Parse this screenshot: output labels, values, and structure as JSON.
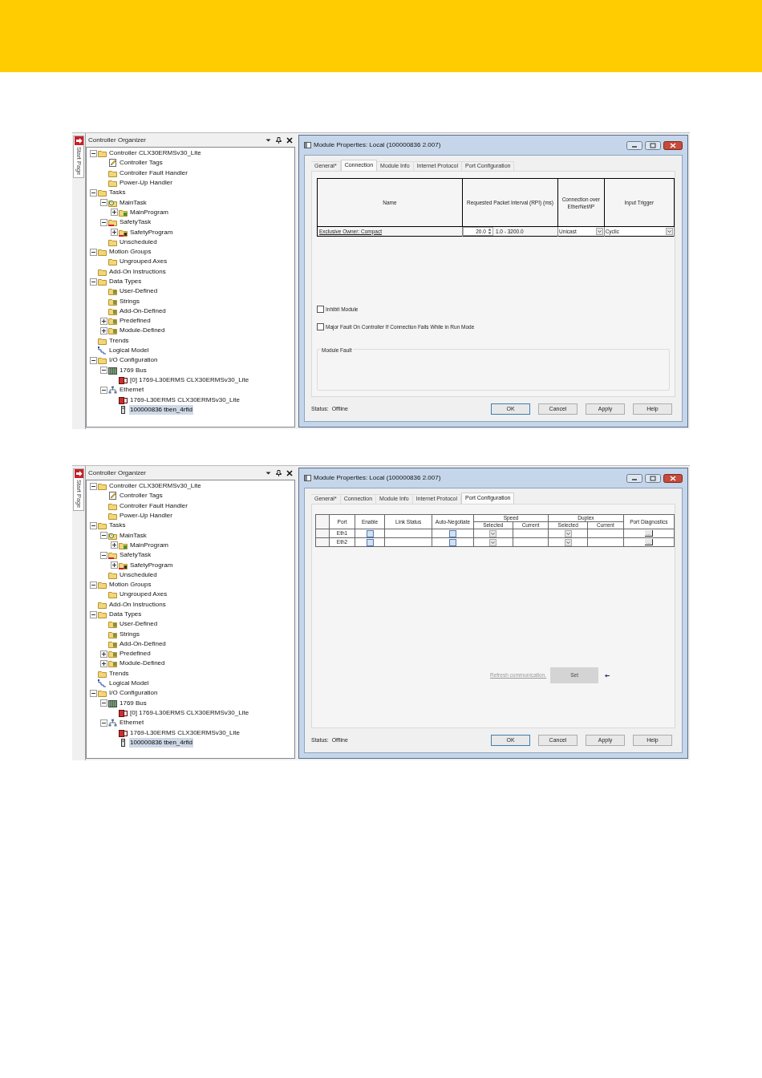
{
  "screens": [
    {
      "organizer": {
        "start_tab": "Start Page",
        "title": "Controller Organizer",
        "tree": [
          {
            "label": "Controller CLX30ERMSv30_Lite",
            "kind": "folder",
            "expanded": true,
            "selected": false,
            "children": [
              {
                "label": "Controller Tags",
                "kind": "tags",
                "selected": false
              },
              {
                "label": "Controller Fault Handler",
                "kind": "folder",
                "selected": false
              },
              {
                "label": "Power-Up Handler",
                "kind": "folder",
                "selected": false
              }
            ]
          },
          {
            "label": "Tasks",
            "kind": "folder",
            "expanded": true,
            "selected": false,
            "children": [
              {
                "label": "MainTask",
                "kind": "task",
                "expanded": true,
                "selected": false,
                "children": [
                  {
                    "label": "MainProgram",
                    "kind": "program",
                    "expanded": false,
                    "selected": false
                  }
                ]
              },
              {
                "label": "SafetyTask",
                "kind": "safety_task",
                "expanded": true,
                "selected": false,
                "children": [
                  {
                    "label": "SafetyProgram",
                    "kind": "safety_program",
                    "expanded": false,
                    "selected": false
                  }
                ]
              },
              {
                "label": "Unscheduled",
                "kind": "folder",
                "selected": false
              }
            ]
          },
          {
            "label": "Motion Groups",
            "kind": "folder",
            "expanded": true,
            "selected": false,
            "children": [
              {
                "label": "Ungrouped Axes",
                "kind": "folder",
                "selected": false
              }
            ]
          },
          {
            "label": "Add-On Instructions",
            "kind": "folder",
            "selected": false
          },
          {
            "label": "Data Types",
            "kind": "folder",
            "expanded": true,
            "selected": false,
            "children": [
              {
                "label": "User-Defined",
                "kind": "datatype",
                "selected": false
              },
              {
                "label": "Strings",
                "kind": "datatype",
                "selected": false
              },
              {
                "label": "Add-On-Defined",
                "kind": "datatype",
                "selected": false
              },
              {
                "label": "Predefined",
                "kind": "datatype",
                "expanded": false,
                "selected": false
              },
              {
                "label": "Module-Defined",
                "kind": "datatype",
                "expanded": false,
                "selected": false
              }
            ]
          },
          {
            "label": "Trends",
            "kind": "folder",
            "selected": false
          },
          {
            "label": "Logical Model",
            "kind": "logical",
            "selected": false
          },
          {
            "label": "I/O Configuration",
            "kind": "folder",
            "expanded": true,
            "selected": false,
            "children": [
              {
                "label": "1769 Bus",
                "kind": "bus",
                "expanded": true,
                "selected": false,
                "children": [
                  {
                    "label": "[0] 1769-L30ERMS CLX30ERMSv30_Lite",
                    "kind": "controller",
                    "selected": false
                  }
                ]
              },
              {
                "label": "Ethernet",
                "kind": "network",
                "expanded": true,
                "selected": false,
                "children": [
                  {
                    "label": "1769-L30ERMS CLX30ERMSv30_Lite",
                    "kind": "controller",
                    "selected": false
                  },
                  {
                    "label": "100000836 tben_4rfid",
                    "kind": "device",
                    "selected": true
                  }
                ]
              }
            ]
          }
        ]
      },
      "dialog": {
        "title": "Module Properties: Local (100000836 2.007)",
        "tabs": [
          {
            "label": "General*",
            "selected": false
          },
          {
            "label": "Connection",
            "selected": true
          },
          {
            "label": "Module Info",
            "selected": false
          },
          {
            "label": "Internet Protocol",
            "selected": false
          },
          {
            "label": "Port Configuration",
            "selected": false
          }
        ],
        "page": {
          "kind": "connection",
          "columns": [
            "Name",
            "Requested Packet Interval (RPI) (ms)",
            "Connection over EtherNet/IP",
            "Input Trigger"
          ],
          "rows": [
            {
              "name": "Exclusive Owner: Compact",
              "rpi": "20.0",
              "range": "1.0 - 3200.0",
              "connection": "Unicast",
              "trigger": "Cyclic"
            }
          ],
          "options": [
            {
              "label": "Inhibit Module",
              "checked": false
            },
            {
              "label": "Major Fault On Controller If Connection Fails While in Run Mode",
              "checked": false
            }
          ],
          "group": "Module Fault"
        },
        "status": "Status:  Offline",
        "buttons": [
          "OK",
          "Cancel",
          "Apply",
          "Help"
        ]
      }
    },
    {
      "organizer": {
        "start_tab": "Start Page",
        "title": "Controller Organizer",
        "tree": [
          {
            "label": "Controller CLX30ERMSv30_Lite",
            "kind": "folder",
            "expanded": true,
            "selected": false,
            "children": [
              {
                "label": "Controller Tags",
                "kind": "tags",
                "selected": false
              },
              {
                "label": "Controller Fault Handler",
                "kind": "folder",
                "selected": false
              },
              {
                "label": "Power-Up Handler",
                "kind": "folder",
                "selected": false
              }
            ]
          },
          {
            "label": "Tasks",
            "kind": "folder",
            "expanded": true,
            "selected": false,
            "children": [
              {
                "label": "MainTask",
                "kind": "task",
                "expanded": true,
                "selected": false,
                "children": [
                  {
                    "label": "MainProgram",
                    "kind": "program",
                    "expanded": false,
                    "selected": false
                  }
                ]
              },
              {
                "label": "SafetyTask",
                "kind": "safety_task",
                "expanded": true,
                "selected": false,
                "children": [
                  {
                    "label": "SafetyProgram",
                    "kind": "safety_program",
                    "expanded": false,
                    "selected": false
                  }
                ]
              },
              {
                "label": "Unscheduled",
                "kind": "folder",
                "selected": false
              }
            ]
          },
          {
            "label": "Motion Groups",
            "kind": "folder",
            "expanded": true,
            "selected": false,
            "children": [
              {
                "label": "Ungrouped Axes",
                "kind": "folder",
                "selected": false
              }
            ]
          },
          {
            "label": "Add-On Instructions",
            "kind": "folder",
            "selected": false
          },
          {
            "label": "Data Types",
            "kind": "folder",
            "expanded": true,
            "selected": false,
            "children": [
              {
                "label": "User-Defined",
                "kind": "datatype",
                "selected": false
              },
              {
                "label": "Strings",
                "kind": "datatype",
                "selected": false
              },
              {
                "label": "Add-On-Defined",
                "kind": "datatype",
                "selected": false
              },
              {
                "label": "Predefined",
                "kind": "datatype",
                "expanded": false,
                "selected": false
              },
              {
                "label": "Module-Defined",
                "kind": "datatype",
                "expanded": false,
                "selected": false
              }
            ]
          },
          {
            "label": "Trends",
            "kind": "folder",
            "selected": false
          },
          {
            "label": "Logical Model",
            "kind": "logical",
            "selected": false
          },
          {
            "label": "I/O Configuration",
            "kind": "folder",
            "expanded": true,
            "selected": false,
            "children": [
              {
                "label": "1769 Bus",
                "kind": "bus",
                "expanded": true,
                "selected": false,
                "children": [
                  {
                    "label": "[0] 1769-L30ERMS CLX30ERMSv30_Lite",
                    "kind": "controller",
                    "selected": false
                  }
                ]
              },
              {
                "label": "Ethernet",
                "kind": "network",
                "expanded": true,
                "selected": false,
                "children": [
                  {
                    "label": "1769-L30ERMS CLX30ERMSv30_Lite",
                    "kind": "controller",
                    "selected": false
                  },
                  {
                    "label": "100000836 tben_4rfid",
                    "kind": "device",
                    "selected": true
                  }
                ]
              }
            ]
          }
        ]
      },
      "dialog": {
        "title": "Module Properties: Local (100000836 2.007)",
        "tabs": [
          {
            "label": "General*",
            "selected": false
          },
          {
            "label": "Connection",
            "selected": false
          },
          {
            "label": "Module Info",
            "selected": false
          },
          {
            "label": "Internet Protocol",
            "selected": false
          },
          {
            "label": "Port Configuration",
            "selected": true
          }
        ],
        "page": {
          "kind": "port_configuration",
          "columns": {
            "port": "Port",
            "enable": "Enable",
            "link_status": "Link Status",
            "auto_negotiate": "Auto-Negotiate",
            "speed": "Speed",
            "speed_selected": "Selected",
            "speed_current": "Current",
            "duplex": "Duplex",
            "duplex_selected": "Selected",
            "duplex_current": "Current",
            "diagnostics": "Port Diagnostics"
          },
          "rows": [
            {
              "port": "Eth1",
              "enable": false,
              "auto_negotiate": false,
              "diagnostics": "..."
            },
            {
              "port": "Eth2",
              "enable": false,
              "auto_negotiate": false,
              "diagnostics": "..."
            }
          ],
          "refresh_link": "Refresh communication.",
          "set_button": {
            "label": "Set",
            "disabled": true
          }
        },
        "status": "Status:  Offline",
        "buttons": [
          "OK",
          "Cancel",
          "Apply",
          "Help"
        ]
      }
    }
  ]
}
